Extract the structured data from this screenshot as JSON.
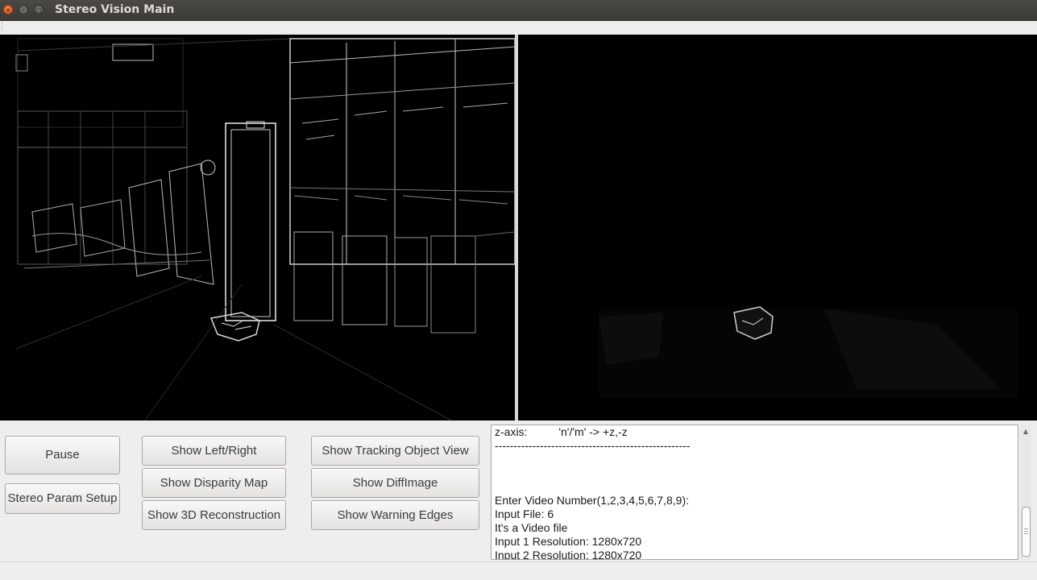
{
  "window": {
    "title": "Stereo Vision Main"
  },
  "controls": {
    "pause": "Pause",
    "stereo_param": "Stereo Param Setup",
    "show_left_right": "Show Left/Right",
    "show_disparity": "Show Disparity Map",
    "show_3d": "Show 3D Reconstruction",
    "show_tracking": "Show Tracking Object View",
    "show_diff": "Show DiffImage",
    "show_warning": "Show Warning Edges"
  },
  "console": {
    "lines": [
      "z-axis:          'n'/'m' -> +z,-z",
      "----------------------------------------------------",
      "",
      "",
      "",
      "Enter Video Number(1,2,3,4,5,6,7,8,9):",
      "Input File: 6",
      "It's a Video file",
      "Input 1 Resolution: 1280x720",
      "Input 2 Resolution: 1280x720"
    ]
  },
  "icons": {
    "close": "close-icon",
    "minimize": "minimize-icon",
    "maximize": "maximize-icon"
  },
  "colors": {
    "titlebar": "#3d3c38",
    "close": "#e5561c",
    "view_bg": "#000000"
  }
}
